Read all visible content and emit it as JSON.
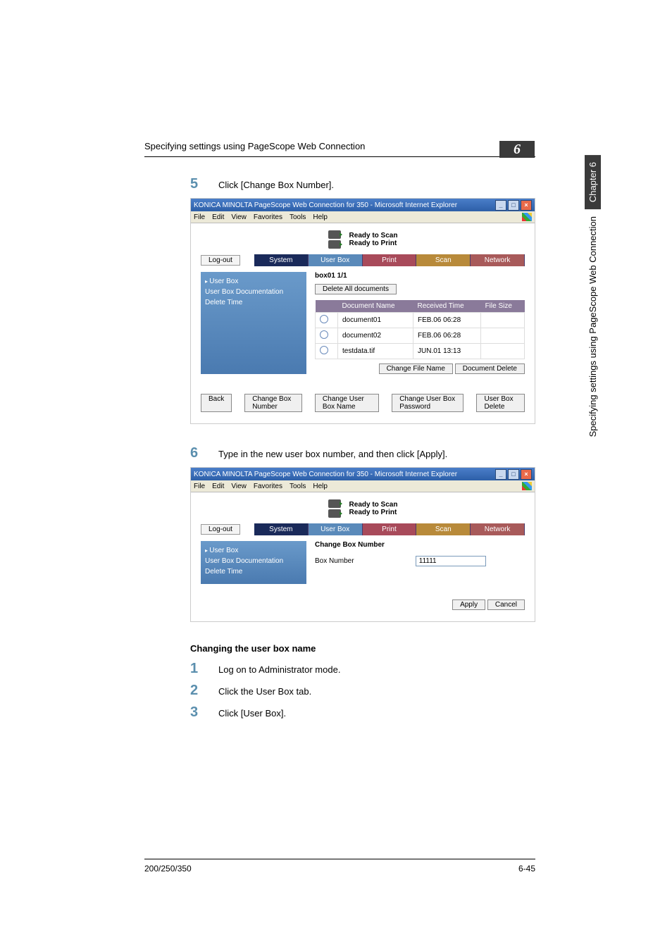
{
  "page": {
    "header_section": "Specifying settings using PageScope Web Connection",
    "chapter_number": "6",
    "side_chapter": "Chapter 6",
    "side_section": "Specifying settings using PageScope Web Connection",
    "footer_model": "200/250/350",
    "footer_page": "6-45"
  },
  "step5": {
    "num": "5",
    "text": "Click [Change Box Number]."
  },
  "step6": {
    "num": "6",
    "text": "Type in the new user box number, and then click [Apply]."
  },
  "subheading": "Changing the user box name",
  "step1": {
    "num": "1",
    "text": "Log on to Administrator mode."
  },
  "step2": {
    "num": "2",
    "text": "Click the User Box tab."
  },
  "step3": {
    "num": "3",
    "text": "Click [User Box]."
  },
  "ie": {
    "title": "KONICA MINOLTA PageScope Web Connection for 350 - Microsoft Internet Explorer",
    "menu": {
      "file": "File",
      "edit": "Edit",
      "view": "View",
      "favorites": "Favorites",
      "tools": "Tools",
      "help": "Help"
    }
  },
  "psw": {
    "ready_scan": "Ready to Scan",
    "ready_print": "Ready to Print",
    "logout": "Log-out",
    "tabs": {
      "system": "System",
      "userbox": "User Box",
      "print": "Print",
      "scan": "Scan",
      "network": "Network"
    },
    "sidebar": {
      "userbox": "User Box",
      "doc": "User Box Documentation",
      "delete": "Delete Time"
    }
  },
  "shot1": {
    "boxid": "box01   1/1",
    "delete_all": "Delete All documents",
    "th": {
      "name": "Document Name",
      "time": "Received Time",
      "size": "File Size"
    },
    "rows": [
      {
        "name": "document01",
        "time": "FEB.06 06:28",
        "size": ""
      },
      {
        "name": "document02",
        "time": "FEB.06 06:28",
        "size": ""
      },
      {
        "name": "testdata.tif",
        "time": "JUN.01 13:13",
        "size": ""
      }
    ],
    "change_file": "Change File Name",
    "doc_delete": "Document Delete",
    "back": "Back",
    "change_box_number": "Change Box Number",
    "change_box_name": "Change User Box Name",
    "change_box_pw": "Change User Box Password",
    "box_delete": "User Box Delete"
  },
  "shot2": {
    "title": "Change Box Number",
    "label": "Box Number",
    "value": "11111",
    "apply": "Apply",
    "cancel": "Cancel"
  }
}
